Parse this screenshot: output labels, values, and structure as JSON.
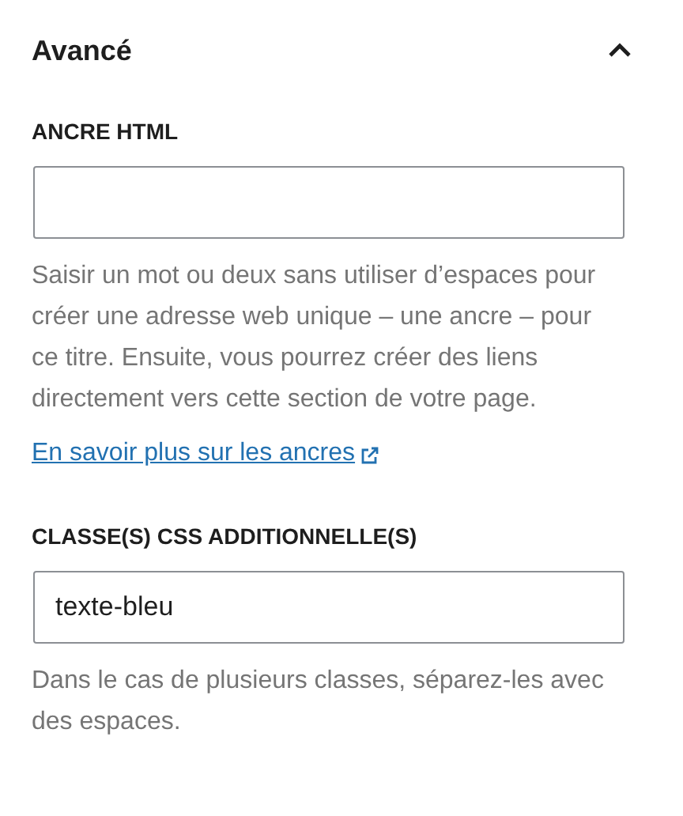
{
  "panel": {
    "title": "Avancé",
    "expanded": true
  },
  "fields": [
    {
      "label": "ANCRE HTML",
      "help": "Saisir un mot ou deux sans utiliser d’espaces pour créer une adresse web unique – une ancre – pour ce titre. Ensuite, vous pourrez créer des liens directement vers cette section de votre page.",
      "link": "En savoir plus sur les ancres"
    },
    {
      "label": "CLASSE(S) CSS ADDITIONNELLE(S)",
      "value": "texte-bleu",
      "help": "Dans le cas de plusieurs classes, séparez-les avec des espaces."
    }
  ]
}
